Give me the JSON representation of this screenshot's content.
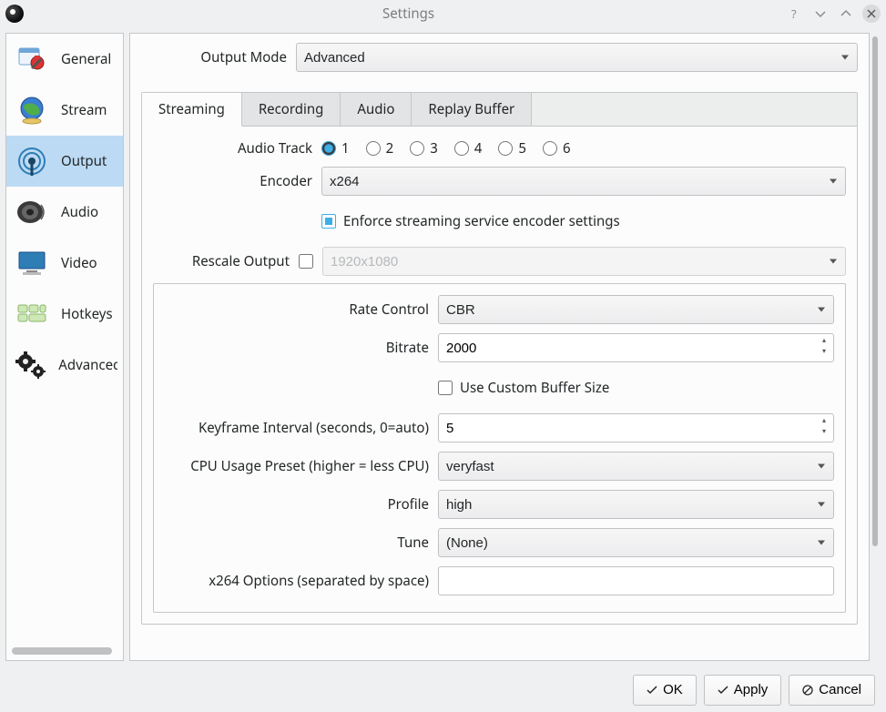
{
  "window": {
    "title": "Settings"
  },
  "sidebar": {
    "items": [
      {
        "label": "General"
      },
      {
        "label": "Stream"
      },
      {
        "label": "Output"
      },
      {
        "label": "Audio"
      },
      {
        "label": "Video"
      },
      {
        "label": "Hotkeys"
      },
      {
        "label": "Advanced"
      }
    ],
    "selected_index": 2
  },
  "output_mode": {
    "label": "Output Mode",
    "value": "Advanced"
  },
  "tabs": [
    {
      "label": "Streaming"
    },
    {
      "label": "Recording"
    },
    {
      "label": "Audio"
    },
    {
      "label": "Replay Buffer"
    }
  ],
  "active_tab": 0,
  "streaming": {
    "audio_track": {
      "label": "Audio Track",
      "options": [
        "1",
        "2",
        "3",
        "4",
        "5",
        "6"
      ],
      "selected": "1"
    },
    "encoder": {
      "label": "Encoder",
      "value": "x264"
    },
    "enforce": {
      "label": "Enforce streaming service encoder settings",
      "checked": true
    },
    "rescale": {
      "label": "Rescale Output",
      "checked": false,
      "value": "1920x1080"
    },
    "rate_control": {
      "label": "Rate Control",
      "value": "CBR"
    },
    "bitrate": {
      "label": "Bitrate",
      "value": "2000"
    },
    "custom_buffer": {
      "label": "Use Custom Buffer Size",
      "checked": false
    },
    "keyframe": {
      "label": "Keyframe Interval (seconds, 0=auto)",
      "value": "5"
    },
    "cpu_preset": {
      "label": "CPU Usage Preset (higher = less CPU)",
      "value": "veryfast"
    },
    "profile": {
      "label": "Profile",
      "value": "high"
    },
    "tune": {
      "label": "Tune",
      "value": "(None)"
    },
    "x264_opts": {
      "label": "x264 Options (separated by space)",
      "value": ""
    }
  },
  "footer": {
    "ok": "OK",
    "apply": "Apply",
    "cancel": "Cancel"
  }
}
